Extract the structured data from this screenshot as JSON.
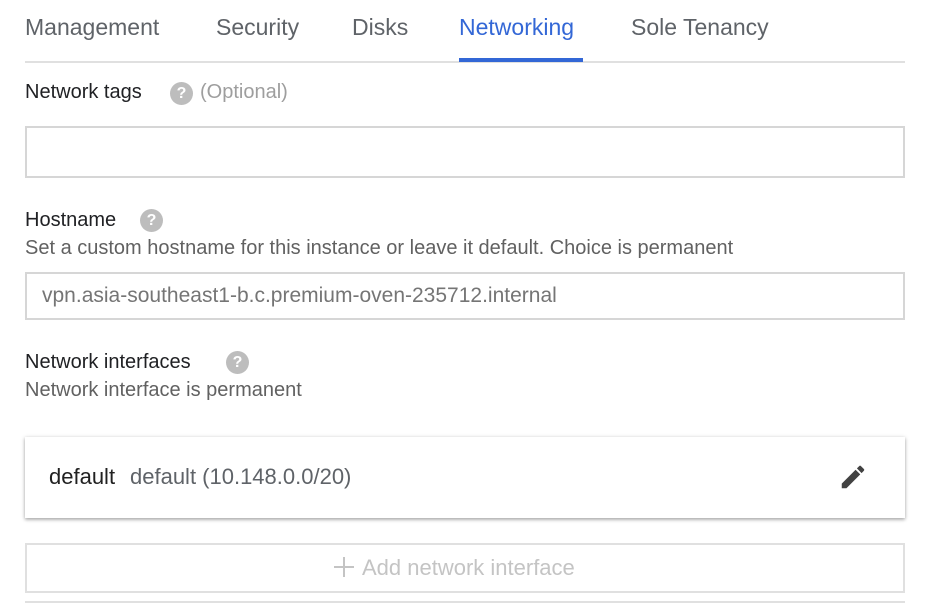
{
  "tabs": [
    {
      "label": "Management"
    },
    {
      "label": "Security"
    },
    {
      "label": "Disks"
    },
    {
      "label": "Networking",
      "active": true
    },
    {
      "label": "Sole Tenancy"
    }
  ],
  "network_tags": {
    "label": "Network tags",
    "optional": "(Optional)",
    "value": "",
    "help_icon": "help-circle-icon"
  },
  "hostname": {
    "label": "Hostname",
    "description": "Set a custom hostname for this instance or leave it default. Choice is permanent",
    "placeholder": "vpn.asia-southeast1-b.c.premium-oven-235712.internal",
    "help_icon": "help-circle-icon"
  },
  "network_interfaces": {
    "label": "Network interfaces",
    "description": "Network interface is permanent",
    "help_icon": "help-circle-icon",
    "items": [
      {
        "name": "default",
        "detail": "default (10.148.0.0/20)",
        "edit_icon": "pencil-icon"
      }
    ],
    "add_button_label": "Add network interface",
    "add_icon": "plus-icon"
  },
  "colors": {
    "accent": "#3367d6",
    "muted_text": "#5f6368",
    "disabled_text": "#c4c4c4",
    "help_icon_bg": "#bdbdbd"
  }
}
